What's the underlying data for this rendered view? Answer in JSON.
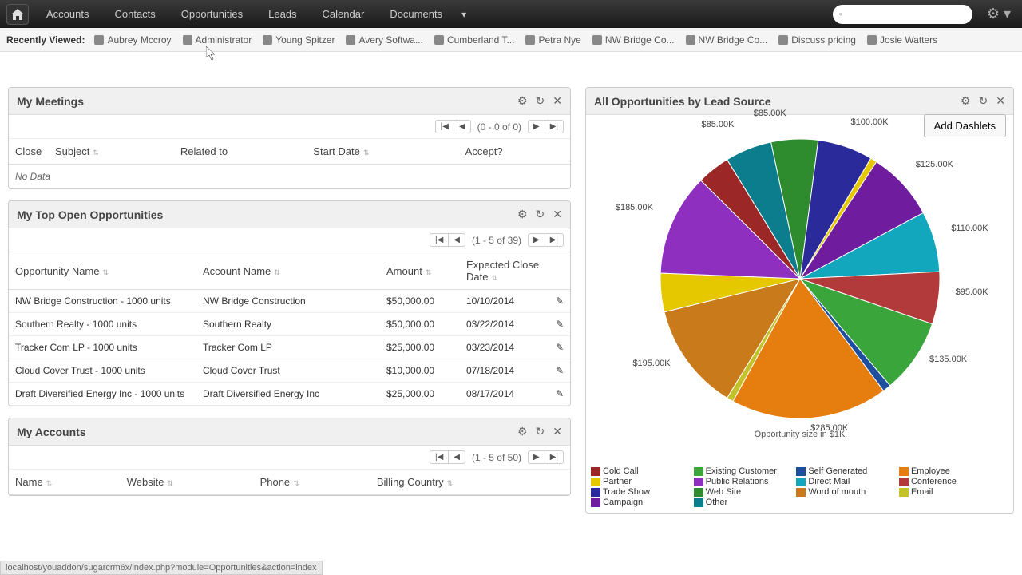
{
  "nav": {
    "items": [
      "Accounts",
      "Contacts",
      "Opportunities",
      "Leads",
      "Calendar",
      "Documents"
    ]
  },
  "recent": {
    "label": "Recently Viewed:",
    "items": [
      "Aubrey Mccroy",
      "Administrator",
      "Young Spitzer",
      "Avery Softwa...",
      "Cumberland T...",
      "Petra Nye",
      "NW Bridge Co...",
      "NW Bridge Co...",
      "Discuss pricing",
      "Josie Watters"
    ]
  },
  "add_dashlets": "Add Dashlets",
  "meetings": {
    "title": "My Meetings",
    "pager": "(0 - 0 of 0)",
    "cols": {
      "close": "Close",
      "subject": "Subject",
      "related": "Related to",
      "start": "Start Date",
      "accept": "Accept?"
    },
    "no_data": "No Data"
  },
  "opps": {
    "title": "My Top Open Opportunities",
    "pager": "(1 - 5 of 39)",
    "cols": {
      "name": "Opportunity Name",
      "account": "Account Name",
      "amount": "Amount",
      "close": "Expected Close Date"
    },
    "rows": [
      {
        "name": "NW Bridge Construction - 1000 units",
        "account": "NW Bridge Construction",
        "amount": "$50,000.00",
        "date": "10/10/2014"
      },
      {
        "name": "Southern Realty - 1000 units",
        "account": "Southern Realty",
        "amount": "$50,000.00",
        "date": "03/22/2014"
      },
      {
        "name": "Tracker Com LP - 1000 units",
        "account": "Tracker Com LP",
        "amount": "$25,000.00",
        "date": "03/23/2014"
      },
      {
        "name": "Cloud Cover Trust - 1000 units",
        "account": "Cloud Cover Trust",
        "amount": "$10,000.00",
        "date": "07/18/2014"
      },
      {
        "name": "Draft Diversified Energy Inc - 1000 units",
        "account": "Draft Diversified Energy Inc",
        "amount": "$25,000.00",
        "date": "08/17/2014"
      }
    ]
  },
  "accounts": {
    "title": "My Accounts",
    "pager": "(1 - 5 of 50)",
    "cols": {
      "name": "Name",
      "website": "Website",
      "phone": "Phone",
      "country": "Billing Country"
    }
  },
  "pie": {
    "title": "All Opportunities by Lead Source",
    "caption": "Opportunity size in $1K",
    "legend": [
      {
        "label": "Cold Call",
        "color": "#9b2727"
      },
      {
        "label": "Existing Customer",
        "color": "#3aa53a"
      },
      {
        "label": "Self Generated",
        "color": "#1d4f9e"
      },
      {
        "label": "Employee",
        "color": "#e57e0f"
      },
      {
        "label": "Partner",
        "color": "#e6c800"
      },
      {
        "label": "Public Relations",
        "color": "#8e2fc0"
      },
      {
        "label": "Direct Mail",
        "color": "#12a7bc"
      },
      {
        "label": "Conference",
        "color": "#b33a3a"
      },
      {
        "label": "Trade Show",
        "color": "#2a2a9a"
      },
      {
        "label": "Web Site",
        "color": "#2e8b2e"
      },
      {
        "label": "Word of mouth",
        "color": "#c97a1a"
      },
      {
        "label": "Email",
        "color": "#c4c22a"
      },
      {
        "label": "Campaign",
        "color": "#6f1d9e"
      },
      {
        "label": "Other",
        "color": "#0c7d8c"
      }
    ]
  },
  "chart_data": {
    "type": "pie",
    "title": "All Opportunities by Lead Source",
    "caption": "Opportunity size in $1K",
    "slices": [
      {
        "label": "$85.00K",
        "value": 85,
        "color": "#0c7d8c"
      },
      {
        "label": "$85.00K",
        "value": 85,
        "color": "#2e8b2e"
      },
      {
        "label": "$100.00K",
        "value": 100,
        "color": "#2a2a9a"
      },
      {
        "label": "",
        "value": 12,
        "color": "#e6c800"
      },
      {
        "label": "$125.00K",
        "value": 125,
        "color": "#6f1d9e"
      },
      {
        "label": "$110.00K",
        "value": 110,
        "color": "#12a7bc"
      },
      {
        "label": "$95.00K",
        "value": 95,
        "color": "#b33a3a"
      },
      {
        "label": "$135.00K",
        "value": 135,
        "color": "#3aa53a"
      },
      {
        "label": "",
        "value": 15,
        "color": "#1d4f9e"
      },
      {
        "label": "$285.00K",
        "value": 285,
        "color": "#e57e0f"
      },
      {
        "label": "",
        "value": 12,
        "color": "#c4c22a"
      },
      {
        "label": "$195.00K",
        "value": 195,
        "color": "#c97a1a"
      },
      {
        "label": "",
        "value": 70,
        "color": "#e6c800"
      },
      {
        "label": "$185.00K",
        "value": 185,
        "color": "#8e2fc0"
      },
      {
        "label": "",
        "value": 60,
        "color": "#9b2727"
      }
    ]
  },
  "status": "localhost/youaddon/sugarcrm6x/index.php?module=Opportunities&action=index"
}
